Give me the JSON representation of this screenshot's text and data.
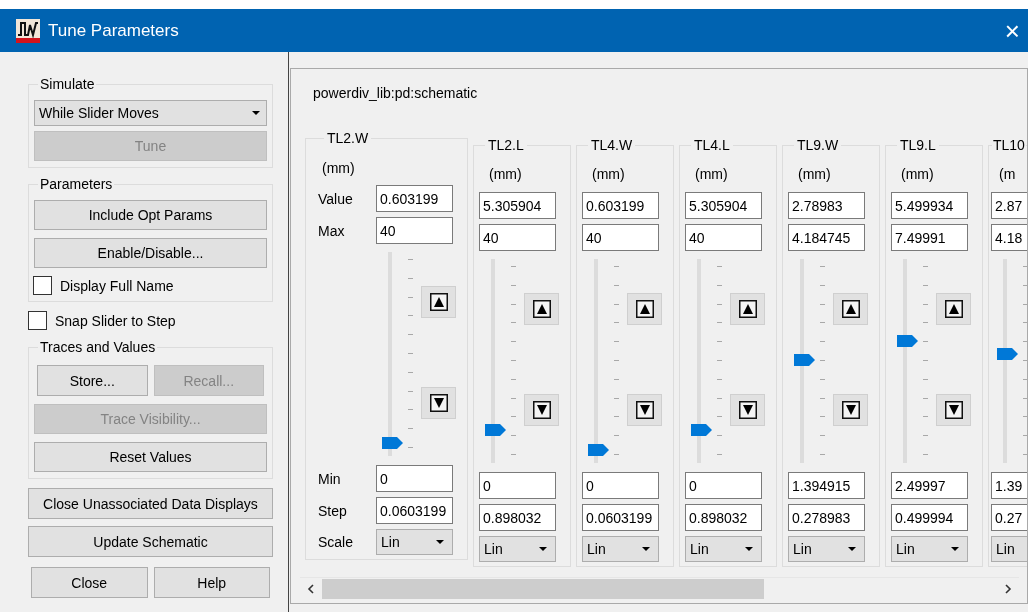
{
  "window": {
    "title": "Tune Parameters",
    "close_glyph": "×"
  },
  "simulate": {
    "label": "Simulate",
    "mode": "While Slider Moves",
    "tune_button": {
      "label": "Tune",
      "disabled": true
    }
  },
  "parameters": {
    "label": "Parameters",
    "buttons": [
      {
        "label": "Include Opt Params",
        "disabled": false
      },
      {
        "label": "Enable/Disable...",
        "disabled": false
      }
    ],
    "display_full_name": {
      "label": "Display Full Name",
      "checked": false
    }
  },
  "snap_slider": {
    "label": "Snap Slider to Step",
    "checked": false
  },
  "traces": {
    "label": "Traces and Values",
    "rows": [
      [
        {
          "label": "Store...",
          "disabled": false
        },
        {
          "label": "Recall...",
          "disabled": true
        }
      ],
      [
        {
          "label": "Trace Visibility...",
          "disabled": true
        }
      ],
      [
        {
          "label": "Reset Values",
          "disabled": false
        }
      ]
    ]
  },
  "actions": [
    {
      "label": "Close Unassociated Data Displays",
      "disabled": false
    },
    {
      "label": "Update Schematic",
      "disabled": false
    }
  ],
  "footer_buttons": [
    {
      "label": "Close",
      "disabled": false
    },
    {
      "label": "Help",
      "disabled": false
    }
  ],
  "design": {
    "name": "powerdiv_lib:pd:schematic",
    "row_labels": {
      "value": "Value",
      "max": "Max",
      "min": "Min",
      "step": "Step",
      "scale": "Scale"
    },
    "columns": [
      {
        "name": "TL2.W",
        "unit": "(mm)",
        "value": "0.603199",
        "max": "40",
        "min": "0",
        "step": "0.0603199",
        "scale": "Lin",
        "level": 0.02,
        "clipped": false
      },
      {
        "name": "TL2.L",
        "unit": "(mm)",
        "value": "5.305904",
        "max": "40",
        "min": "0",
        "step": "0.898032",
        "scale": "Lin",
        "level": 0.13,
        "clipped": false
      },
      {
        "name": "TL4.W",
        "unit": "(mm)",
        "value": "0.603199",
        "max": "40",
        "min": "0",
        "step": "0.0603199",
        "scale": "Lin",
        "level": 0.02,
        "clipped": false
      },
      {
        "name": "TL4.L",
        "unit": "(mm)",
        "value": "5.305904",
        "max": "40",
        "min": "0",
        "step": "0.898032",
        "scale": "Lin",
        "level": 0.13,
        "clipped": false
      },
      {
        "name": "TL9.W",
        "unit": "(mm)",
        "value": "2.78983",
        "max": "4.184745",
        "min": "1.394915",
        "step": "0.278983",
        "scale": "Lin",
        "level": 0.5,
        "clipped": false
      },
      {
        "name": "TL9.L",
        "unit": "(mm)",
        "value": "5.499934",
        "max": "7.49991",
        "min": "2.49997",
        "step": "0.499994",
        "scale": "Lin",
        "level": 0.6,
        "clipped": false
      },
      {
        "name": "TL10",
        "unit": "(m",
        "value": "2.87",
        "max": "4.18",
        "min": "1.39",
        "step": "0.27",
        "scale": "Lin",
        "level": 0.53,
        "clipped": true
      }
    ]
  }
}
